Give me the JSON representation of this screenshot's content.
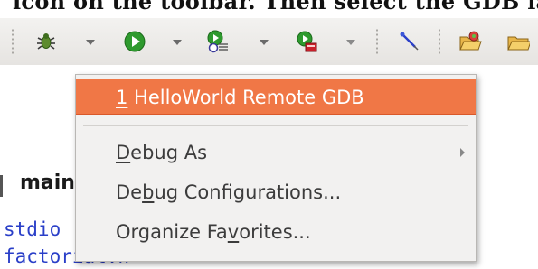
{
  "doc_heading": "icon on the toolbar. Then select the GDB launc",
  "toolbar": {
    "icons": [
      "debug-bug-icon",
      "run-icon",
      "run-config-icon",
      "external-tools-icon",
      "pin-icon",
      "open-folder-icon",
      "folder-icon"
    ]
  },
  "editor": {
    "tab_label": "main",
    "code_lines": [
      "stdio",
      "factorial.h"
    ]
  },
  "menu": {
    "items": [
      {
        "mnemonic": "1",
        "rest": " HelloWorld Remote GDB",
        "selected": true
      },
      {
        "pre": "",
        "mnemonic": "D",
        "rest": "ebug As",
        "has_submenu": true
      },
      {
        "pre": "De",
        "mnemonic": "b",
        "rest": "ug Configurations..."
      },
      {
        "pre": "Organize Fa",
        "mnemonic": "v",
        "rest": "orites..."
      }
    ]
  },
  "colors": {
    "selection": "#f07746",
    "menu_bg": "#f2f1f0",
    "code_text": "#2a3fc8"
  }
}
